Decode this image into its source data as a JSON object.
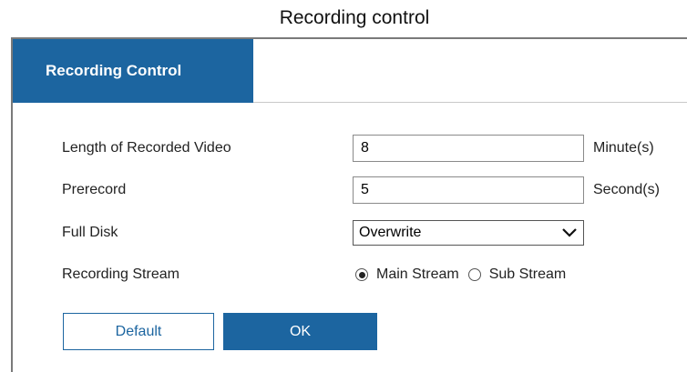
{
  "caption": "Recording control",
  "tab": {
    "label": "Recording Control"
  },
  "form": {
    "length": {
      "label": "Length of Recorded Video",
      "value": "8",
      "unit": "Minute(s)"
    },
    "prerecord": {
      "label": "Prerecord",
      "value": "5",
      "unit": "Second(s)"
    },
    "full_disk": {
      "label": "Full Disk",
      "selected": "Overwrite"
    },
    "stream": {
      "label": "Recording Stream",
      "options": [
        {
          "label": "Main Stream",
          "checked": true
        },
        {
          "label": "Sub Stream",
          "checked": false
        }
      ]
    }
  },
  "buttons": {
    "default_label": "Default",
    "ok_label": "OK"
  },
  "colors": {
    "accent": "#1c65a0"
  }
}
